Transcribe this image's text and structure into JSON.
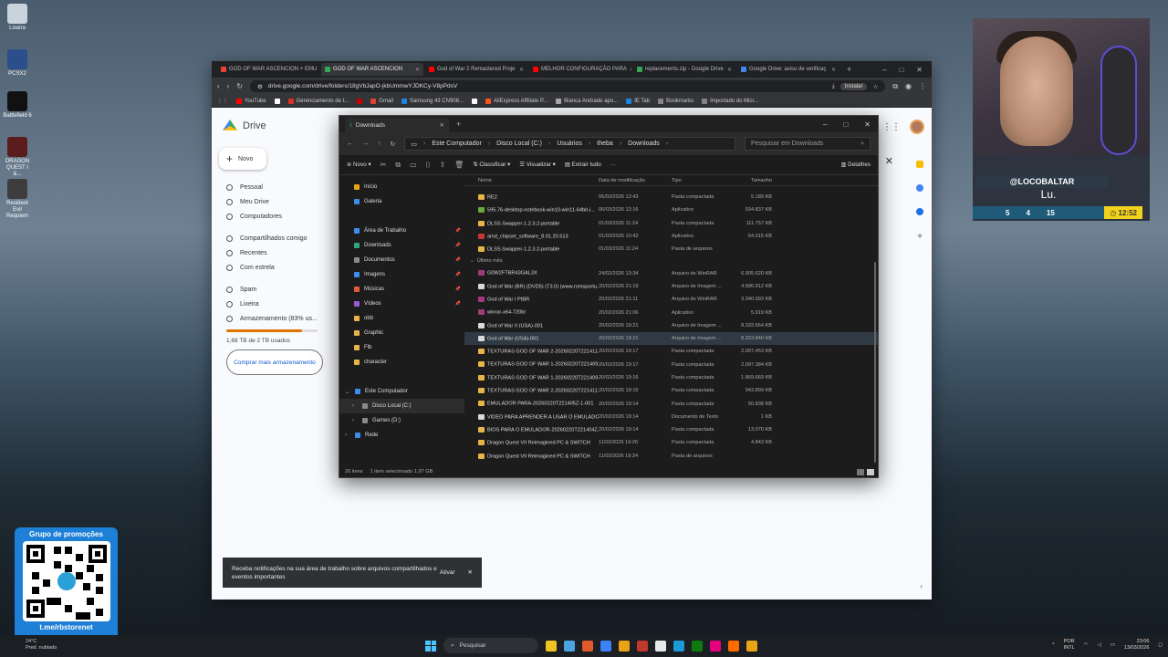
{
  "desktop": {
    "icons": [
      {
        "label": "Lixeira",
        "color": "#c8d3dc"
      },
      {
        "label": "PCSX2",
        "color": "#2a4f8a"
      },
      {
        "label": "Battlefield 6",
        "color": "#111111"
      },
      {
        "label": "DRAGON QUEST I &...",
        "color": "#5a1c1c"
      },
      {
        "label": "Resident Evil Requiem",
        "color": "#3d3d3d"
      }
    ]
  },
  "browser": {
    "tabs": [
      {
        "label": "GOD OF WAR ASCENCION + EMU",
        "color": "#ea4335",
        "active": false
      },
      {
        "label": "GOD OF WAR ASCENCION",
        "color": "#34a853",
        "active": true
      },
      {
        "label": "God of War 2 Remastered Proje",
        "color": "#ff0000",
        "active": false
      },
      {
        "label": "MELHOR CONFIGURAÇÃO PARA",
        "color": "#ff0000",
        "active": false
      },
      {
        "label": "replacements.zip - Google Drive",
        "color": "#34a853",
        "active": false
      },
      {
        "label": "Google Drive: aviso de verificaç",
        "color": "#4285f4",
        "active": false
      }
    ],
    "url": "drive.google.com/drive/folders/18gVbJapO-jkbUmmwYJDKCy-V8pPdsV",
    "install_label": "Instalar",
    "bookmarks": [
      {
        "label": "YouTube",
        "color": "#ff0000"
      },
      {
        "label": "",
        "color": "#ffffff"
      },
      {
        "label": "Gerenciamento de t...",
        "color": "#d93025"
      },
      {
        "label": "",
        "color": "#cc0000"
      },
      {
        "label": "Gmail",
        "color": "#ea4335"
      },
      {
        "label": "Samsung 43 CN908...",
        "color": "#1e88e5"
      },
      {
        "label": "",
        "color": "#ffffff"
      },
      {
        "label": "AliExpress Affiliate P...",
        "color": "#ff5722"
      },
      {
        "label": "Bianca Andrade apo...",
        "color": "#aaaaaa"
      },
      {
        "label": "IE Tab",
        "color": "#1e88e5"
      },
      {
        "label": "Bookmarks",
        "color": "#888888"
      },
      {
        "label": "Importado do Micr...",
        "color": "#888888"
      }
    ]
  },
  "drive": {
    "title": "Drive",
    "new_label": "Novo",
    "nav": [
      {
        "label": "Pessoal",
        "group": 1
      },
      {
        "label": "Meu Drive",
        "group": 1
      },
      {
        "label": "Computadores",
        "group": 1
      },
      {
        "label": "Compartilhados comigo",
        "group": 2
      },
      {
        "label": "Recentes",
        "group": 2
      },
      {
        "label": "Com estrela",
        "group": 2
      },
      {
        "label": "Spam",
        "group": 3
      },
      {
        "label": "Lixeira",
        "group": 3
      },
      {
        "label": "Armazenamento (83% us...",
        "group": 3
      }
    ],
    "storage_text": "1,68 TB de 2 TB usados",
    "storage_fraction": 0.83,
    "buy_label": "Comprar mais armazenamento",
    "toast_text": "Receba notificações na sua área de trabalho sobre arquivos compartilhados e eventos importantes",
    "toast_action": "Ativar"
  },
  "explorer": {
    "tab_title": "Downloads",
    "breadcrumbs": [
      "Este Computador",
      "Disco Local (C:)",
      "Usuários",
      "theba",
      "Downloads"
    ],
    "search_placeholder": "Pesquisar em Downloads",
    "commands": {
      "new": "Novo",
      "sort": "Classificar",
      "view": "Visualizar",
      "extract": "Extrair tudo",
      "more": "···",
      "details": "Detalhes"
    },
    "nav": [
      {
        "label": "Início",
        "color": "#e8a317",
        "pin": false,
        "indent": 0
      },
      {
        "label": "Galeria",
        "color": "#3b8eea",
        "pin": false,
        "indent": 0
      },
      {
        "label": "",
        "gap": true
      },
      {
        "label": "Área de Trabalho",
        "color": "#3b8eea",
        "pin": true,
        "indent": 0
      },
      {
        "label": "Downloads",
        "color": "#2aa876",
        "pin": true,
        "indent": 0
      },
      {
        "label": "Documentos",
        "color": "#8a8a8a",
        "pin": true,
        "indent": 0
      },
      {
        "label": "Imagens",
        "color": "#3b8eea",
        "pin": true,
        "indent": 0
      },
      {
        "label": "Músicas",
        "color": "#e35a3b",
        "pin": true,
        "indent": 0
      },
      {
        "label": "Vídeos",
        "color": "#9b59d6",
        "pin": true,
        "indent": 0
      },
      {
        "label": "obb",
        "color": "#e8b447",
        "pin": false,
        "indent": 0
      },
      {
        "label": "Graphic",
        "color": "#e8b447",
        "pin": false,
        "indent": 0
      },
      {
        "label": "Flb",
        "color": "#e8b447",
        "pin": false,
        "indent": 0
      },
      {
        "label": "character",
        "color": "#e8b447",
        "pin": false,
        "indent": 0
      },
      {
        "label": "",
        "gap": true
      },
      {
        "label": "Este Computador",
        "color": "#3b8eea",
        "pin": false,
        "indent": 0,
        "chev": "v"
      },
      {
        "label": "Disco Local (C:)",
        "color": "#8a8a8a",
        "pin": false,
        "indent": 1,
        "chev": ">",
        "selected": true
      },
      {
        "label": "Games (D:)",
        "color": "#8a8a8a",
        "pin": false,
        "indent": 1,
        "chev": ">"
      },
      {
        "label": "Rede",
        "color": "#3b8eea",
        "pin": false,
        "indent": 0,
        "chev": ">"
      }
    ],
    "columns": [
      "Nome",
      "Data de modificação",
      "Tipo",
      "Tamanho"
    ],
    "rows_before": [
      {
        "name": "RE2",
        "date": "06/03/2026 13:43",
        "type": "Pasta compactada",
        "size": "5.189 KB",
        "icon": "#e8b447"
      },
      {
        "name": "595.76-desktop-notebook-win10-win11-64bit-i...",
        "date": "06/03/2026 12:16",
        "type": "Aplicativo",
        "size": "934.837 KB",
        "icon": "#6aaa3a"
      },
      {
        "name": "DLSS.Swapper-1.2.3.2-portable",
        "date": "01/03/2026 11:24",
        "type": "Pasta compactada",
        "size": "111.757 KB",
        "icon": "#e8b447"
      },
      {
        "name": "amd_chipset_software_8.01.20.513",
        "date": "01/03/2026 10:42",
        "type": "Aplicativo",
        "size": "64.015 KB",
        "icon": "#cc3333"
      },
      {
        "name": "DLSS.Swapper-1.2.3.2-portable",
        "date": "01/03/2026 11:24",
        "type": "Pasta de arquivos",
        "size": "",
        "icon": "#e8b447"
      }
    ],
    "group_label": "Último mês",
    "rows_after": [
      {
        "name": "G0W2FTBR43GAL3X",
        "date": "24/02/2026 13:34",
        "type": "Arquivo do WinRAR",
        "size": "6.905.620 KB",
        "icon": "#a03a7a"
      },
      {
        "name": "God of War (BR) (DVD5) (T3.0) (www.romsportu...",
        "date": "20/02/2026 21:19",
        "type": "Arquivo de Imagem ...",
        "size": "4.586.912 KB",
        "icon": "#d9d9d9"
      },
      {
        "name": "God of War I PtBR",
        "date": "20/02/2026 21:11",
        "type": "Arquivo do WinRAR",
        "size": "3.340.993 KB",
        "icon": "#a03a7a"
      },
      {
        "name": "winrar-x64-720br",
        "date": "20/02/2026 21:06",
        "type": "Aplicativo",
        "size": "5.919 KB",
        "icon": "#a03a7a"
      },
      {
        "name": "God of War II (USA)-001",
        "date": "20/02/2026 19:21",
        "type": "Arquivo de Imagem ...",
        "size": "8.333.664 KB",
        "icon": "#d9d9d9"
      },
      {
        "name": "God of War (USA)-001",
        "date": "20/02/2026 19:21",
        "type": "Arquivo de Imagem ...",
        "size": "8.323.840 KB",
        "icon": "#d9d9d9",
        "selected": true
      },
      {
        "name": "TEXTURAS GOD OF WAR 2-20260220T221411...",
        "date": "20/02/2026 19:17",
        "type": "Pasta compactada",
        "size": "2.097.453 KB",
        "icon": "#e8b447"
      },
      {
        "name": "TEXTURAS GOD OF WAR 1-20260220T221409...",
        "date": "20/02/2026 19:17",
        "type": "Pasta compactada",
        "size": "2.097.384 KB",
        "icon": "#e8b447"
      },
      {
        "name": "TEXTURAS GOD OF WAR 1-20260220T221409...",
        "date": "20/02/2026 19:16",
        "type": "Pasta compactada",
        "size": "1.869.669 KB",
        "icon": "#e8b447"
      },
      {
        "name": "TEXTURAS GOD OF WAR 2-20260220T221411...",
        "date": "20/02/2026 19:15",
        "type": "Pasta compactada",
        "size": "943.899 KB",
        "icon": "#e8b447"
      },
      {
        "name": "EMULADOR PARA-20260220T221405Z-1-001",
        "date": "20/02/2026 19:14",
        "type": "Pasta compactada",
        "size": "50.838 KB",
        "icon": "#e8b447"
      },
      {
        "name": "VIDEO PARA APRENDER A USAR O EMULADOR",
        "date": "20/02/2026 19:14",
        "type": "Documento de Texto",
        "size": "1 KB",
        "icon": "#d9d9d9"
      },
      {
        "name": "BIOS PARA O EMULADOR-20260220T221404Z...",
        "date": "20/02/2026 19:14",
        "type": "Pasta compactada",
        "size": "13.070 KB",
        "icon": "#e8b447"
      },
      {
        "name": "Dragon Quest VII Reimagined PC & SWITCH",
        "date": "11/02/2026 19:26",
        "type": "Pasta compactada",
        "size": "4.843 KB",
        "icon": "#e8b447"
      },
      {
        "name": "Dragon Quest VII Reimagined PC & SWITCH",
        "date": "11/02/2026 19:34",
        "type": "Pasta de arquivos",
        "size": "",
        "icon": "#e8b447"
      }
    ],
    "status_count": "26 itens",
    "status_selected": "1 item selecionado  1,97 GB"
  },
  "stream": {
    "handle": "@LOCOBALTAR",
    "name": "Lu.",
    "stats": [
      "5",
      "4",
      "15"
    ],
    "clock": "12:52",
    "promo_title": "Grupo de promoções",
    "promo_link": "t.me/rbstorenet"
  },
  "taskbar": {
    "weather_temp": "24°C",
    "weather_text": "Pred. nublado",
    "search_label": "Pesquisar",
    "apps": [
      "#f0c420",
      "#4aa3df",
      "#e05a2b",
      "#3b82f6",
      "#e8a317",
      "#c0392b",
      "#e8e8e8",
      "#1b9bd7",
      "#0f7b0f",
      "#e6007e",
      "#ff6a00",
      "#e8a317"
    ],
    "lang_top": "POR",
    "lang_bottom": "INTL",
    "time": "23:06",
    "date": "13/03/2026"
  }
}
